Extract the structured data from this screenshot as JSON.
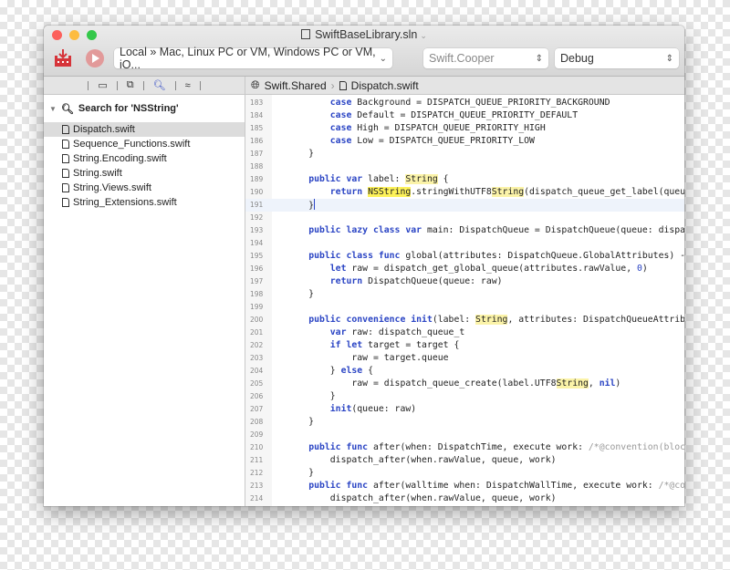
{
  "window": {
    "title": "SwiftBaseLibrary.sln",
    "traffic_colors": [
      "#fc605c",
      "#fdbc40",
      "#34c84a"
    ]
  },
  "toolbar": {
    "target": "Local » Mac, Linux PC or VM, Windows PC or VM, iO...",
    "project": "Swift.Cooper",
    "configuration": "Debug",
    "accent": "#d6343a"
  },
  "breadcrumb": [
    "Swift.Shared",
    "Dispatch.swift"
  ],
  "navigator": {
    "search_title": "Search for 'NSString'",
    "files": [
      "Dispatch.swift",
      "Sequence_Functions.swift",
      "String.Encoding.swift",
      "String.swift",
      "String.Views.swift",
      "String_Extensions.swift"
    ],
    "selected": 0
  },
  "editor": {
    "current_line": 191,
    "lines": [
      {
        "n": "183",
        "t": [
          [
            "",
            "            "
          ],
          [
            "k",
            "case"
          ],
          [
            "",
            " Background = DISPATCH_QUEUE_PRIORITY_BACKGROUND"
          ]
        ]
      },
      {
        "n": "184",
        "t": [
          [
            "",
            "            "
          ],
          [
            "k",
            "case"
          ],
          [
            "",
            " Default = DISPATCH_QUEUE_PRIORITY_DEFAULT"
          ]
        ]
      },
      {
        "n": "185",
        "t": [
          [
            "",
            "            "
          ],
          [
            "k",
            "case"
          ],
          [
            "",
            " High = DISPATCH_QUEUE_PRIORITY_HIGH"
          ]
        ]
      },
      {
        "n": "186",
        "t": [
          [
            "",
            "            "
          ],
          [
            "k",
            "case"
          ],
          [
            "",
            " Low = DISPATCH_QUEUE_PRIORITY_LOW"
          ]
        ]
      },
      {
        "n": "187",
        "t": [
          [
            "",
            "        }"
          ]
        ]
      },
      {
        "n": "188",
        "t": []
      },
      {
        "n": "189",
        "t": [
          [
            "",
            "        "
          ],
          [
            "k",
            "public var"
          ],
          [
            "",
            " label: "
          ],
          [
            "hs",
            "String"
          ],
          [
            "",
            " {"
          ]
        ]
      },
      {
        "n": "190",
        "t": [
          [
            "",
            "            "
          ],
          [
            "k",
            "return"
          ],
          [
            "",
            " "
          ],
          [
            "hb",
            "NSString"
          ],
          [
            "",
            ".stringWithUTF8"
          ],
          [
            "hs",
            "String"
          ],
          [
            "",
            "(dispatch_queue_get_label(queue))"
          ]
        ]
      },
      {
        "n": "191",
        "t": [
          [
            "",
            "        }"
          ],
          [
            "caret",
            ""
          ]
        ]
      },
      {
        "n": "192",
        "t": []
      },
      {
        "n": "193",
        "t": [
          [
            "",
            "        "
          ],
          [
            "k",
            "public lazy class var"
          ],
          [
            "",
            " main: DispatchQueue = DispatchQueue(queue: dispatch_get_main_queue())"
          ]
        ]
      },
      {
        "n": "194",
        "t": []
      },
      {
        "n": "195",
        "t": [
          [
            "",
            "        "
          ],
          [
            "k",
            "public class func"
          ],
          [
            "",
            " global(attributes: DispatchQueue.GlobalAttributes) -> DispatchQueue {"
          ]
        ]
      },
      {
        "n": "196",
        "t": [
          [
            "",
            "            "
          ],
          [
            "k",
            "let"
          ],
          [
            "",
            " raw = dispatch_get_global_queue(attributes.rawValue, "
          ],
          [
            "n",
            "0"
          ],
          [
            "",
            ")"
          ]
        ]
      },
      {
        "n": "197",
        "t": [
          [
            "",
            "            "
          ],
          [
            "k",
            "return"
          ],
          [
            "",
            " DispatchQueue(queue: raw)"
          ]
        ]
      },
      {
        "n": "198",
        "t": [
          [
            "",
            "        }"
          ]
        ]
      },
      {
        "n": "199",
        "t": []
      },
      {
        "n": "200",
        "t": [
          [
            "",
            "        "
          ],
          [
            "k",
            "public convenience init"
          ],
          [
            "",
            "(label: "
          ],
          [
            "hs",
            "String"
          ],
          [
            "",
            ", attributes: DispatchQueueAttributes"
          ]
        ]
      },
      {
        "n": "201",
        "t": [
          [
            "",
            "            "
          ],
          [
            "k",
            "var"
          ],
          [
            "",
            " raw: dispatch_queue_t"
          ]
        ]
      },
      {
        "n": "202",
        "t": [
          [
            "",
            "            "
          ],
          [
            "k",
            "if let"
          ],
          [
            "",
            " target = target {"
          ]
        ]
      },
      {
        "n": "203",
        "t": [
          [
            "",
            "                raw = target.queue"
          ]
        ]
      },
      {
        "n": "204",
        "t": [
          [
            "",
            "            } "
          ],
          [
            "k",
            "else"
          ],
          [
            "",
            " {"
          ]
        ]
      },
      {
        "n": "205",
        "t": [
          [
            "",
            "                raw = dispatch_queue_create(label.UTF8"
          ],
          [
            "hs",
            "String"
          ],
          [
            "",
            ", "
          ],
          [
            "k",
            "nil"
          ],
          [
            "",
            ")"
          ]
        ]
      },
      {
        "n": "206",
        "t": [
          [
            "",
            "            }"
          ]
        ]
      },
      {
        "n": "207",
        "t": [
          [
            "",
            "            "
          ],
          [
            "k",
            "init"
          ],
          [
            "",
            "(queue: raw)"
          ]
        ]
      },
      {
        "n": "208",
        "t": [
          [
            "",
            "        }"
          ]
        ]
      },
      {
        "n": "209",
        "t": []
      },
      {
        "n": "210",
        "t": [
          [
            "",
            "        "
          ],
          [
            "k",
            "public func"
          ],
          [
            "",
            " after(when: DispatchTime, execute work: "
          ],
          [
            "c",
            "/*@convention(block)*/"
          ]
        ]
      },
      {
        "n": "211",
        "t": [
          [
            "",
            "            dispatch_after(when.rawValue, queue, work)"
          ]
        ]
      },
      {
        "n": "212",
        "t": [
          [
            "",
            "        }"
          ]
        ]
      },
      {
        "n": "213",
        "t": [
          [
            "",
            "        "
          ],
          [
            "k",
            "public func"
          ],
          [
            "",
            " after(walltime when: DispatchWallTime, execute work: "
          ],
          [
            "c",
            "/*@convention(block)*/"
          ]
        ]
      },
      {
        "n": "214",
        "t": [
          [
            "",
            "            dispatch_after(when.rawValue, queue, work)"
          ]
        ]
      }
    ]
  }
}
